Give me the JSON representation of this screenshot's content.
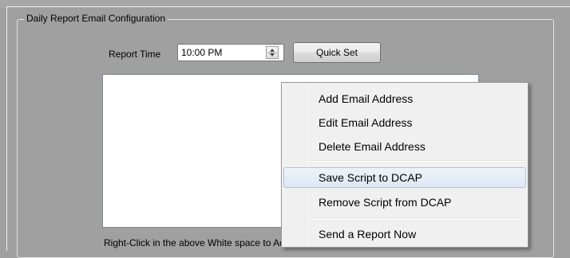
{
  "group": {
    "title": "Daily Report Email Configuration"
  },
  "report_time": {
    "label": "Report Time",
    "value": "10:00 PM"
  },
  "quick_set": {
    "label": "Quick Set"
  },
  "hint": {
    "text": "Right-Click in the above White space to Add, Edit and Delete."
  },
  "context_menu": {
    "items": [
      {
        "label": "Add Email Address"
      },
      {
        "label": "Edit Email Address"
      },
      {
        "label": "Delete Email Address"
      },
      {
        "label": "Save Script to DCAP",
        "highlighted": true
      },
      {
        "label": "Remove Script from DCAP"
      },
      {
        "label": "Send a Report Now"
      }
    ]
  },
  "colors": {
    "background": "#a0a0a0",
    "menu_highlight": "#dde8f5",
    "menu_highlight_border": "#a9c4e6"
  }
}
